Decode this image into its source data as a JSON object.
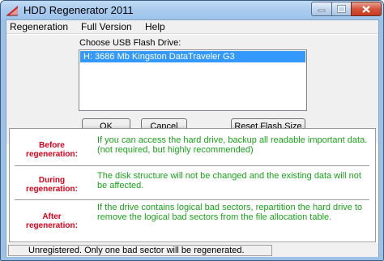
{
  "window": {
    "title": "HDD Regenerator 2011",
    "icon": "hdd-regenerator-app-icon"
  },
  "menu": {
    "items": [
      "Regeneration",
      "Full Version",
      "Help"
    ]
  },
  "usb": {
    "choose_label": "Choose USB Flash Drive:",
    "drives": [
      "H:  3686 Mb   Kingston DataTraveler G3"
    ],
    "selected_index": 0
  },
  "buttons": {
    "ok": "OK",
    "cancel": "Cancel",
    "reset": "Reset Flash Size"
  },
  "info": [
    {
      "label": [
        "Before",
        "regeneration:"
      ],
      "text": "If you can access the hard drive, backup all readable important data. (not required, but highly recommended)"
    },
    {
      "label": [
        "During",
        "regeneration:"
      ],
      "text": "The disk structure will not be changed and the existing data will not be affected."
    },
    {
      "label": [
        "After",
        "regeneration:"
      ],
      "text": "If the drive contains logical bad sectors, repartition the hard drive to remove the logical bad sectors from the file allocation table."
    }
  ],
  "status": {
    "text": "Unregistered. Only one bad sector will be regenerated."
  },
  "colors": {
    "label_red": "#e0001a",
    "text_green": "#1aa31a",
    "selection_blue": "#3399ff"
  }
}
